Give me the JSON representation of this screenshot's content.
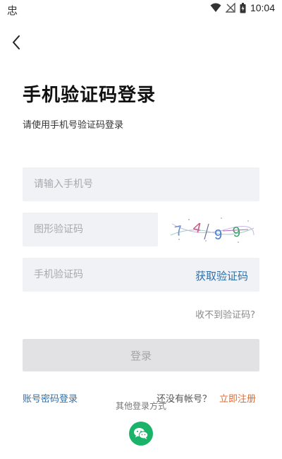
{
  "status_bar": {
    "app_glyph": "忠",
    "time": "10:04",
    "icons": [
      "wifi-icon",
      "signal-off-icon",
      "battery-icon"
    ]
  },
  "header": {
    "back_icon": "back-arrow-icon"
  },
  "title": "手机验证码登录",
  "subtitle": "请使用手机号验证码登录",
  "form": {
    "phone_placeholder": "请输入手机号",
    "image_code_placeholder": "图形验证码",
    "captcha_text": "7499",
    "sms_code_placeholder": "手机验证码",
    "get_code_label": "获取验证码",
    "no_code_link": "收不到验证码?",
    "login_button": "登录"
  },
  "footer": {
    "password_login": "账号密码登录",
    "no_account": "还没有帐号？",
    "register": "立即注册",
    "other_methods": "其他登录方式",
    "wechat_icon": "wechat-icon"
  },
  "colors": {
    "accent_blue": "#2f6fa8",
    "register_orange": "#e26a2c",
    "field_bg": "#f1f2f6",
    "button_disabled_bg": "#e2e2e4",
    "wechat_green": "#1ab36a"
  }
}
